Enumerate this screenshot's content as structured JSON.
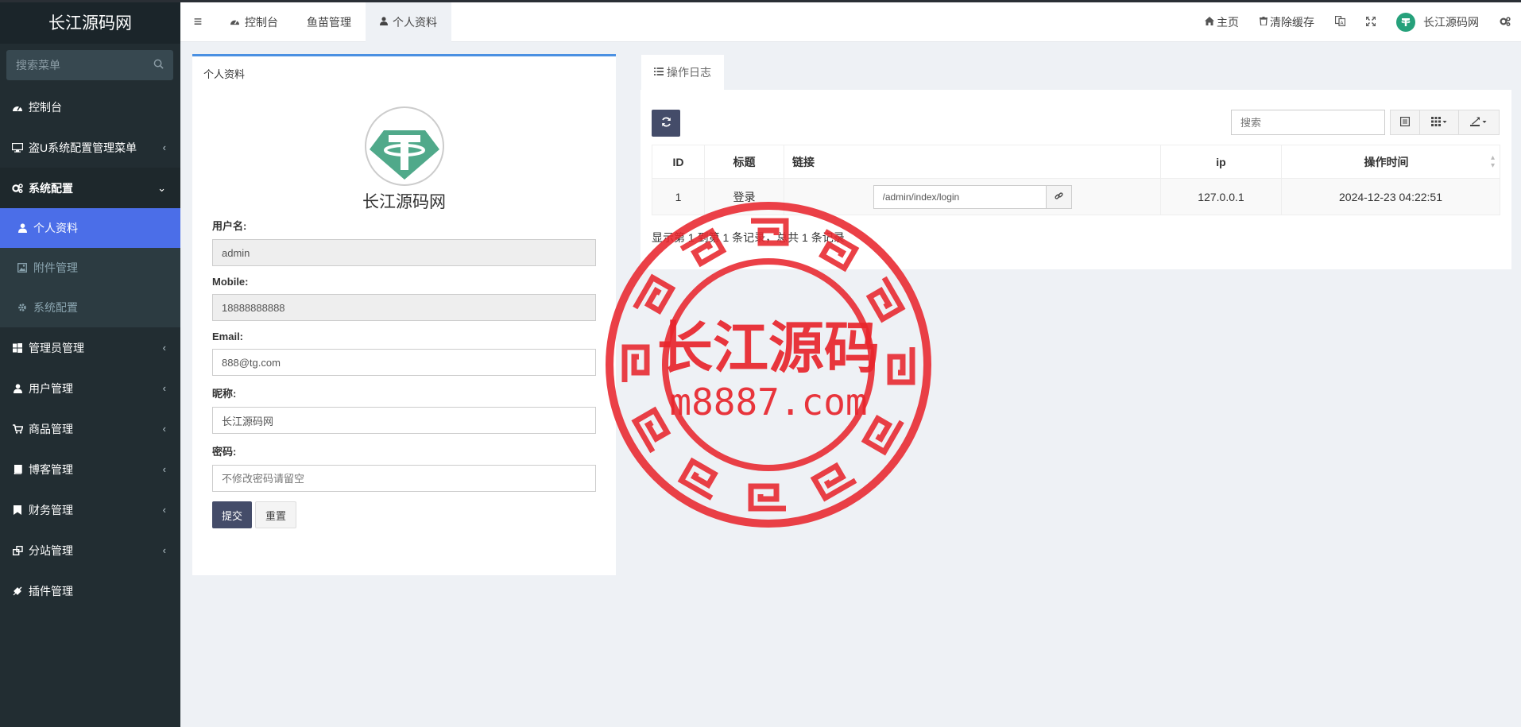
{
  "app": {
    "logo_text": "长江源码网"
  },
  "sidebar": {
    "search_placeholder": "搜索菜单",
    "items": [
      {
        "label": "控制台",
        "icon": "dashboard-icon"
      },
      {
        "label": "盗U系统配置管理菜单",
        "icon": "desktop-icon"
      },
      {
        "label": "系统配置",
        "icon": "cogs-icon"
      }
    ],
    "sub_items": [
      {
        "label": "个人资料",
        "icon": "user-icon"
      },
      {
        "label": "附件管理",
        "icon": "image-icon"
      },
      {
        "label": "系统配置",
        "icon": "gear-icon"
      }
    ],
    "items2": [
      {
        "label": "管理员管理",
        "icon": "windows-icon"
      },
      {
        "label": "用户管理",
        "icon": "user-icon"
      },
      {
        "label": "商品管理",
        "icon": "cart-icon"
      },
      {
        "label": "博客管理",
        "icon": "book-icon"
      },
      {
        "label": "财务管理",
        "icon": "bookmark-icon"
      },
      {
        "label": "分站管理",
        "icon": "clone-icon"
      },
      {
        "label": "插件管理",
        "icon": "plug-icon"
      }
    ]
  },
  "navbar": {
    "tabs": [
      {
        "label": "控制台"
      },
      {
        "label": "鱼苗管理"
      },
      {
        "label": "个人资料"
      }
    ],
    "home_label": "主页",
    "clear_cache_label": "清除缓存",
    "user_name": "长江源码网"
  },
  "profile": {
    "panel_title": "个人资料",
    "display_name": "长江源码网",
    "username_label": "用户名:",
    "username_value": "admin",
    "mobile_label": "Mobile:",
    "mobile_value": "18888888888",
    "email_label": "Email:",
    "email_value": "888@tg.com",
    "nickname_label": "昵称:",
    "nickname_value": "长江源码网",
    "password_label": "密码:",
    "password_placeholder": "不修改密码请留空",
    "submit_label": "提交",
    "reset_label": "重置"
  },
  "log": {
    "tab_label": "操作日志",
    "search_placeholder": "搜索",
    "columns": [
      "ID",
      "标题",
      "链接",
      "ip",
      "操作时间"
    ],
    "rows": [
      {
        "id": "1",
        "title": "登录",
        "link": "/admin/index/login",
        "ip": "127.0.0.1",
        "time": "2024-12-23 04:22:51"
      }
    ],
    "summary": "显示第 1 到第 1 条记录，总共 1 条记录"
  },
  "watermark": {
    "title": "长江源码",
    "url": "m8887.com",
    "color": "#e8262d"
  }
}
